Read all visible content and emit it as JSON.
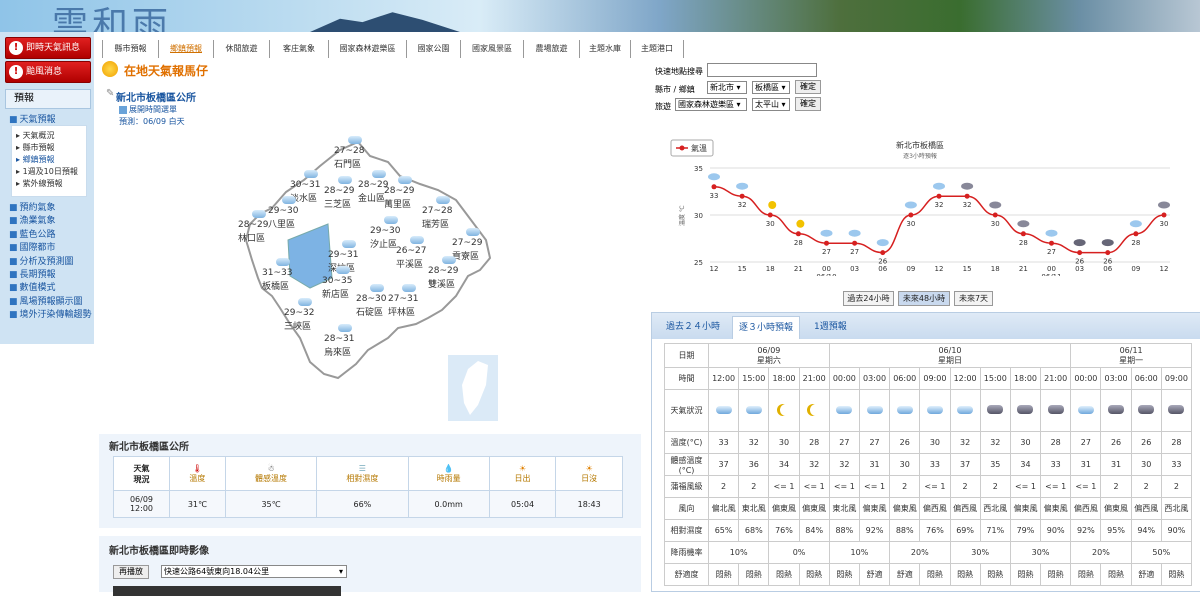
{
  "banner": {
    "logo_text": "雲和雨"
  },
  "left_nav": {
    "alert_buttons": [
      "即時天氣訊息",
      "颱風消息"
    ],
    "section_title": "預報",
    "selected_item": "天氣預報",
    "sub_items": [
      "天氣概況",
      "縣市預報",
      "鄉鎮預報",
      "1週及10日預報",
      "紫外線預報"
    ],
    "items": [
      "預約氣象",
      "漁業氣象",
      "藍色公路",
      "國際都市",
      "分析及預測圖",
      "長期預報",
      "數值模式",
      "風場預報顯示圖",
      "境外汙染傳輸趨勢"
    ]
  },
  "top_tabs": [
    "縣市預報",
    "鄉鎮預報",
    "休閒旅遊",
    "客庄氣象",
    "國家森林遊樂區",
    "國家公園",
    "國家風景區",
    "農場旅遊",
    "主題水庫",
    "主題港口"
  ],
  "page": {
    "section_title": "在地天氣報馬仔",
    "location_title": "新北市板橋區公所",
    "expand_label": "展開時間選單",
    "forecast_label": "預測：06/09 白天"
  },
  "map": {
    "districts": [
      {
        "name": "石門區",
        "temp": "27~28"
      },
      {
        "name": "淡水區",
        "temp": "30~31"
      },
      {
        "name": "三芝區",
        "temp": "28~29"
      },
      {
        "name": "金山區",
        "temp": "28~29"
      },
      {
        "name": "萬里區",
        "temp": "28~29"
      },
      {
        "name": "八里區",
        "temp": "29~30"
      },
      {
        "name": "林口區",
        "temp": "28~29"
      },
      {
        "name": "瑞芳區",
        "temp": "27~28"
      },
      {
        "name": "汐止區",
        "temp": "29~30"
      },
      {
        "name": "貢寮區",
        "temp": "27~29"
      },
      {
        "name": "平溪區",
        "temp": "26~27"
      },
      {
        "name": "深坑區",
        "temp": "29~31"
      },
      {
        "name": "板橋區",
        "temp": "31~33"
      },
      {
        "name": "雙溪區",
        "temp": "28~29"
      },
      {
        "name": "新店區",
        "temp": "30~35"
      },
      {
        "name": "石碇區",
        "temp": "28~30"
      },
      {
        "name": "坪林區",
        "temp": "27~31"
      },
      {
        "name": "三峽區",
        "temp": "29~32"
      },
      {
        "name": "烏來區",
        "temp": "28~31"
      }
    ]
  },
  "observation": {
    "title": "新北市板橋區公所",
    "row_header": "天氣\n現況",
    "columns": [
      "溫度",
      "體感溫度",
      "相對濕度",
      "時雨量",
      "日出",
      "日沒"
    ],
    "time": "06/09\n12:00",
    "values": [
      "31℃",
      "35℃",
      "66%",
      "0.0mm",
      "05:04",
      "18:43"
    ]
  },
  "live_cam": {
    "title": "新北市板橋區即時影像",
    "replay_label": "再播放",
    "camera_option": "快速公路64號東向18.04公里"
  },
  "quick_search": {
    "label": "快速地點搜尋",
    "county_label": "縣市 / 鄉鎮",
    "county_value": "新北市",
    "district_value": "板橋區",
    "travel_label": "旅遊",
    "travel_type": "國家森林遊樂區",
    "travel_place": "太平山",
    "confirm_label": "確定"
  },
  "chart_data": {
    "type": "line",
    "title": "新北市板橋區",
    "subtitle": "逐3小時預報",
    "legend": "氣溫",
    "ylabel": "溫度 ℃",
    "ylim": [
      25,
      35
    ],
    "yticks": [
      25,
      30,
      35
    ],
    "x": [
      "12",
      "15",
      "18",
      "21",
      "00",
      "03",
      "06",
      "09",
      "12",
      "15",
      "18",
      "21",
      "00",
      "03",
      "06",
      "09",
      "12"
    ],
    "date_labels": [
      {
        "at": 4,
        "text": "06/10"
      },
      {
        "at": 12,
        "text": "06/11"
      }
    ],
    "values": [
      33,
      32,
      30,
      28,
      27,
      27,
      26,
      30,
      32,
      32,
      30,
      28,
      27,
      26,
      26,
      28,
      30
    ],
    "icons": [
      "cloud",
      "cloud",
      "moon",
      "moon",
      "cloud",
      "cloud",
      "cloud",
      "cloud",
      "cloud",
      "rain",
      "rain",
      "rain",
      "cloud",
      "dark",
      "dark",
      "cloud",
      "rain"
    ],
    "color": "#d62020"
  },
  "range_buttons": [
    "過去24小時",
    "未來48小時",
    "未來7天"
  ],
  "forecast_tabs": [
    "過去２４小時",
    "逐３小時預報",
    "1週預報"
  ],
  "forecast_table": {
    "row_labels": [
      "日期",
      "時間",
      "天氣狀況",
      "溫度(°C)",
      "體感溫度(°C)",
      "蒲福風級",
      "風向",
      "相對濕度",
      "降雨機率",
      "舒適度"
    ],
    "dates": [
      {
        "date": "06/09",
        "day": "星期六"
      },
      {
        "date": "06/10",
        "day": "星期日"
      },
      {
        "date": "06/11",
        "day": "星期一"
      }
    ],
    "times": [
      "12:00",
      "15:00",
      "18:00",
      "21:00",
      "00:00",
      "03:00",
      "06:00",
      "09:00",
      "12:00",
      "15:00",
      "18:00",
      "21:00",
      "00:00",
      "03:00",
      "06:00",
      "09:00"
    ],
    "weather": [
      "cloud",
      "cloud",
      "moon",
      "moon",
      "cloud",
      "cloud",
      "cloud",
      "cloud",
      "cloud",
      "rain",
      "rain",
      "rain",
      "cloud",
      "dark",
      "dark",
      "rain"
    ],
    "temp": [
      "33",
      "32",
      "30",
      "28",
      "27",
      "27",
      "26",
      "30",
      "32",
      "32",
      "30",
      "28",
      "27",
      "26",
      "26",
      "28"
    ],
    "feel": [
      "37",
      "36",
      "34",
      "32",
      "32",
      "31",
      "30",
      "33",
      "37",
      "35",
      "34",
      "33",
      "31",
      "31",
      "30",
      "33"
    ],
    "beaufort": [
      "2",
      "2",
      "<= 1",
      "<= 1",
      "<= 1",
      "<= 1",
      "2",
      "<= 1",
      "2",
      "2",
      "<= 1",
      "<= 1",
      "<= 1",
      "2",
      "2",
      "2"
    ],
    "wind_dir": [
      "偏北風",
      "東北風",
      "偏東風",
      "偏東風",
      "東北風",
      "偏東風",
      "偏東風",
      "偏西風",
      "偏西風",
      "西北風",
      "偏東風",
      "偏東風",
      "偏西風",
      "偏東風",
      "偏西風",
      "西北風"
    ],
    "humidity": [
      "65%",
      "68%",
      "76%",
      "84%",
      "88%",
      "92%",
      "88%",
      "76%",
      "69%",
      "71%",
      "79%",
      "90%",
      "92%",
      "95%",
      "94%",
      "90%"
    ],
    "rain_prob": [
      "10%",
      "0%",
      "10%",
      "20%",
      "30%",
      "30%",
      "20%",
      "50%"
    ],
    "comfort": [
      "悶熱",
      "悶熱",
      "悶熱",
      "悶熱",
      "悶熱",
      "舒適",
      "舒適",
      "悶熱",
      "悶熱",
      "悶熱",
      "悶熱",
      "悶熱",
      "悶熱",
      "悶熱",
      "舒適",
      "悶熱"
    ]
  }
}
